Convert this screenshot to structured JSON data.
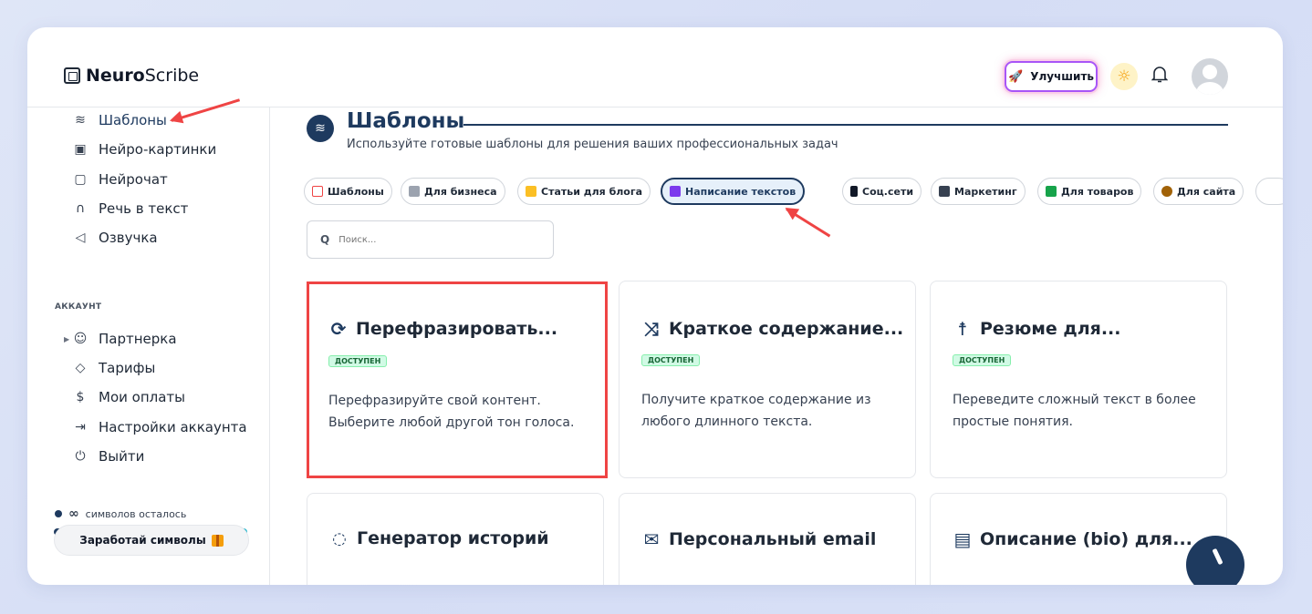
{
  "header": {
    "logo_bold": "Neuro",
    "logo_rest": "Scribe",
    "upgrade_label": "Улучшить"
  },
  "sidebar": {
    "items": [
      {
        "label": "Шаблоны",
        "icon": "layers-icon"
      },
      {
        "label": "Нейро-картинки",
        "icon": "image-icon"
      },
      {
        "label": "Нейрочат",
        "icon": "chat-icon"
      },
      {
        "label": "Речь в текст",
        "icon": "headphones-icon"
      },
      {
        "label": "Озвучка",
        "icon": "speaker-icon"
      }
    ],
    "section_label": "АККАУНТ",
    "account_items": [
      {
        "label": "Партнерка",
        "icon": "users-icon"
      },
      {
        "label": "Тарифы",
        "icon": "tag-icon"
      },
      {
        "label": "Мои оплаты",
        "icon": "dollar-icon"
      },
      {
        "label": "Настройки аккаунта",
        "icon": "login-icon"
      },
      {
        "label": "Выйти",
        "icon": "power-icon"
      }
    ],
    "symbols_infinity": "∞",
    "symbols_text": "символов осталось",
    "earn_label": "Заработай символы"
  },
  "main": {
    "title": "Шаблоны",
    "subtitle": "Используйте готовые шаблоны для решения ваших профессиональных задач",
    "chips": [
      {
        "label": "Шаблоны",
        "color": "#ef4444"
      },
      {
        "label": "Для бизнеса",
        "color": "#6b7280"
      },
      {
        "label": "Статьи для блога",
        "color": "#f59e0b"
      },
      {
        "label": "Написание текстов",
        "color": "#7c3aed",
        "active": true
      },
      {
        "label": "Соц.сети",
        "color": "#111827"
      },
      {
        "label": "Маркетинг",
        "color": "#374151"
      },
      {
        "label": "Для товаров",
        "color": "#16a34a"
      },
      {
        "label": "Для сайта",
        "color": "#a16207"
      }
    ],
    "search_placeholder": "Поиск...",
    "cards": [
      {
        "title": "Перефразировать...",
        "icon": "refresh-icon",
        "badge": "ДОСТУПЕН",
        "desc": "Перефразируйте свой контент. Выберите любой другой тон голоса."
      },
      {
        "title": "Краткое содержание...",
        "icon": "compress-icon",
        "badge": "ДОСТУПЕН",
        "desc": "Получите краткое содержание из любого длинного текста."
      },
      {
        "title": "Резюме для...",
        "icon": "person-icon",
        "badge": "ДОСТУПЕН",
        "desc": "Переведите сложный текст в более простые понятия."
      },
      {
        "title": "Генератор историй",
        "icon": "circle-icon"
      },
      {
        "title": "Персональный email",
        "icon": "envelope-icon"
      },
      {
        "title": "Описание (bio) для...",
        "icon": "document-icon"
      }
    ]
  }
}
